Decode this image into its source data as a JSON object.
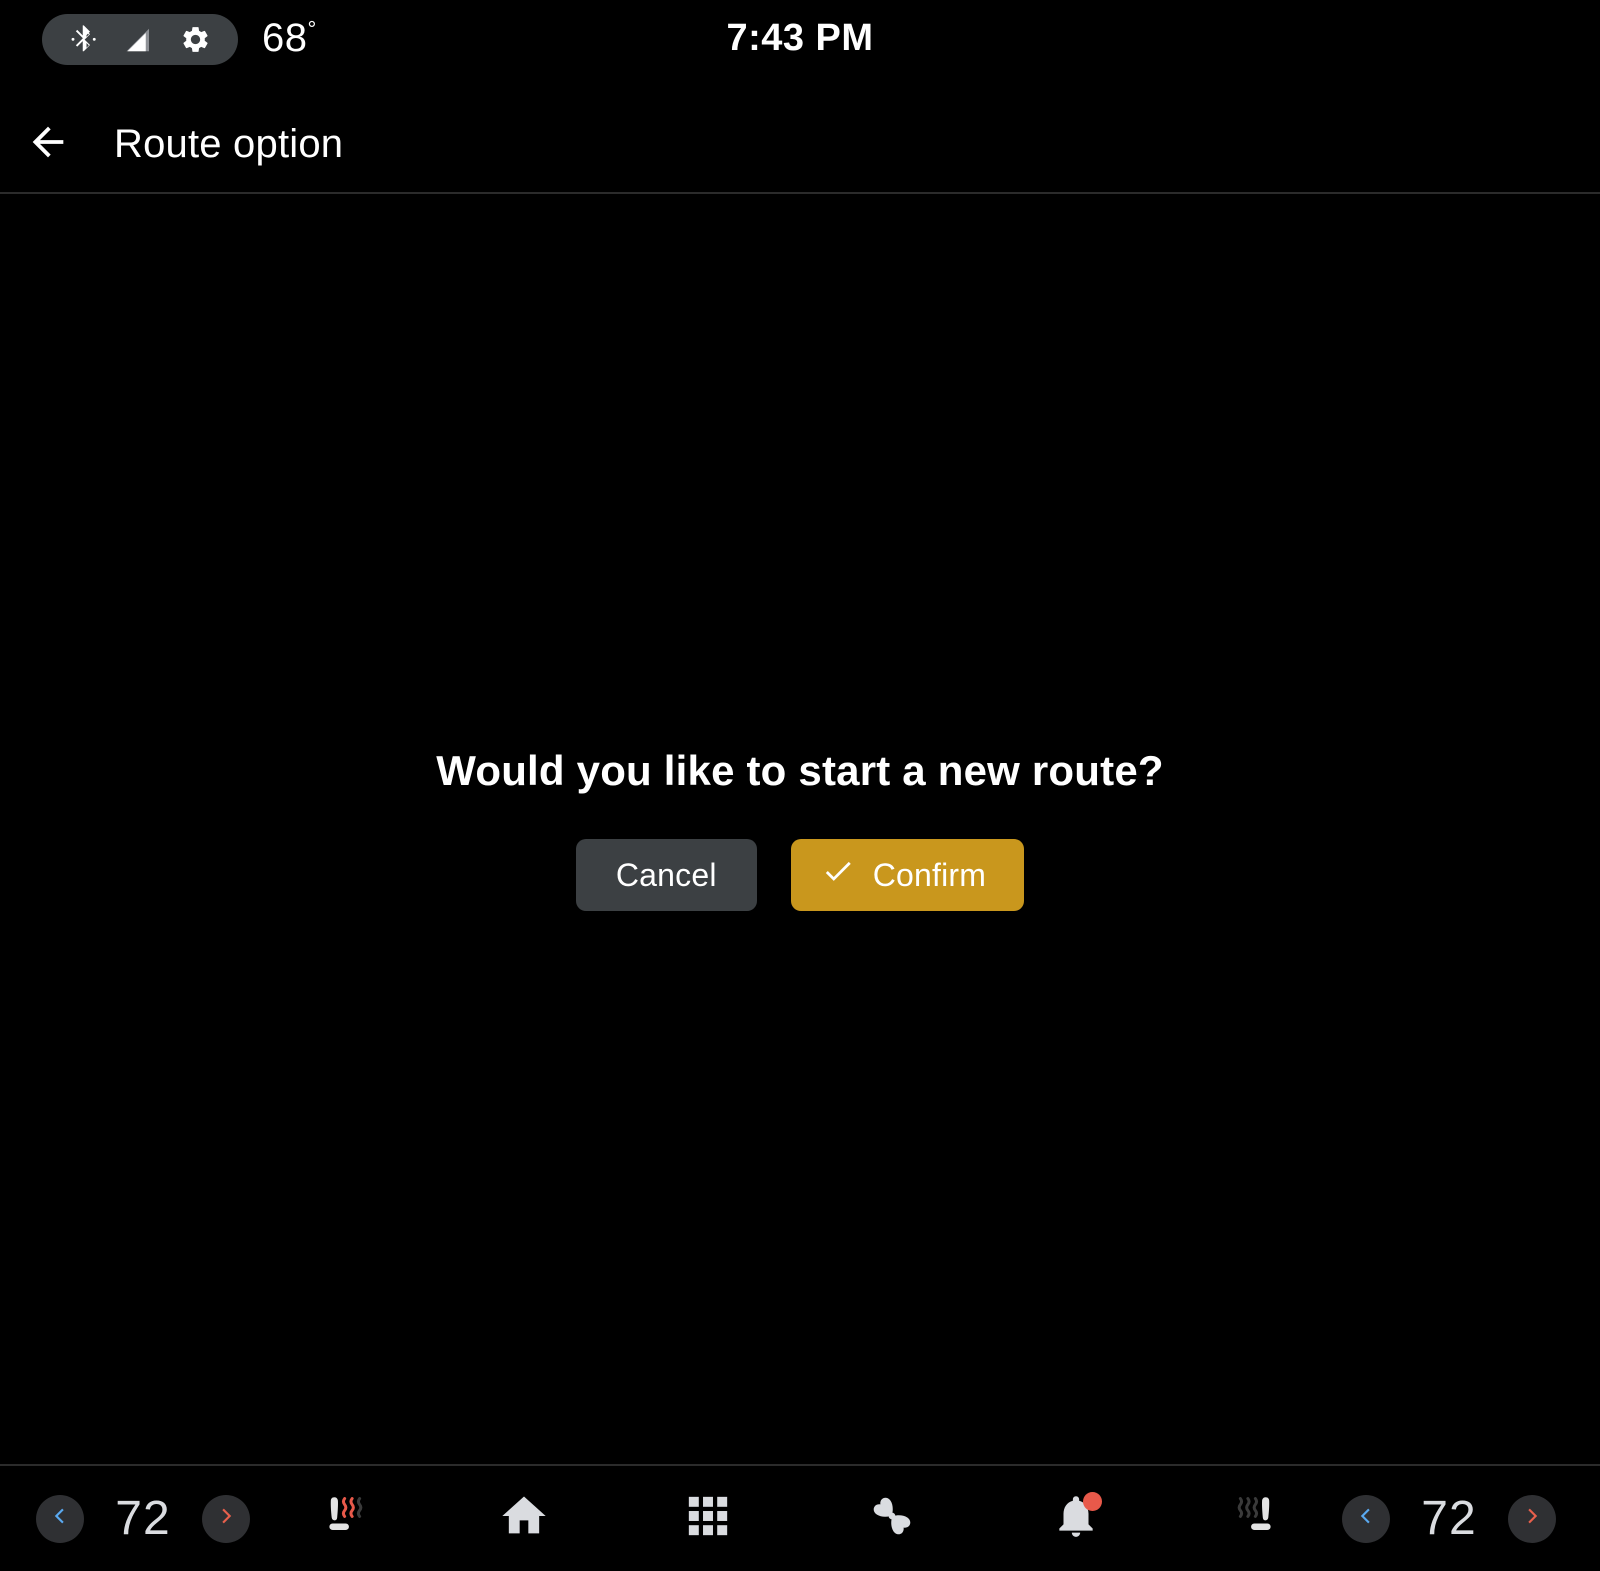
{
  "status_bar": {
    "bluetooth_icon": "bluetooth-icon",
    "signal_icon": "signal-bars-icon",
    "settings_icon": "gear-icon",
    "temperature": "68",
    "degree_symbol": "°",
    "clock": "7:43 PM",
    "pill_color": "#3c4043"
  },
  "header": {
    "back_icon": "arrow-left-icon",
    "title": "Route option"
  },
  "dialog": {
    "message": "Would you like to start a new route?",
    "cancel_label": "Cancel",
    "confirm_label": "Confirm",
    "confirm_icon": "check-icon",
    "cancel_color": "#3c4043",
    "confirm_color": "#c9971d"
  },
  "bottom_bar": {
    "left_temp": {
      "decrease_icon": "chevron-left-icon",
      "value": "72",
      "increase_icon": "chevron-right-icon"
    },
    "left_seat": {
      "icon": "heated-seat-icon",
      "active_level": 2,
      "total_levels": 3
    },
    "nav": [
      {
        "icon": "home-icon",
        "name": "home"
      },
      {
        "icon": "apps-grid-icon",
        "name": "apps"
      },
      {
        "icon": "fan-icon",
        "name": "climate"
      },
      {
        "icon": "bell-icon",
        "name": "notifications",
        "badge": true
      }
    ],
    "right_seat": {
      "icon": "heated-seat-icon",
      "active_level": 0,
      "total_levels": 3
    },
    "right_temp": {
      "decrease_icon": "chevron-left-icon",
      "value": "72",
      "increase_icon": "chevron-right-icon"
    },
    "colors": {
      "decrease_chevron": "#5aa9f0",
      "increase_chevron": "#e8604c",
      "heat_active": "#e8594a",
      "heat_inactive": "#3a3a3a",
      "badge": "#e8594a",
      "icon": "#dadce0"
    }
  }
}
